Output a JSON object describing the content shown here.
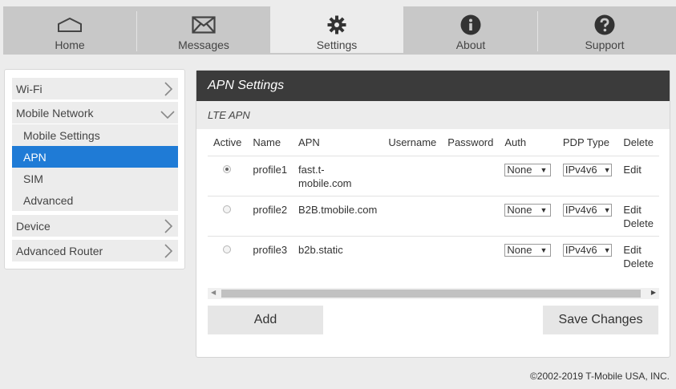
{
  "nav": {
    "tabs": [
      {
        "label": "Home",
        "icon": "home-icon"
      },
      {
        "label": "Messages",
        "icon": "envelope-icon"
      },
      {
        "label": "Settings",
        "icon": "gear-icon"
      },
      {
        "label": "About",
        "icon": "info-icon"
      },
      {
        "label": "Support",
        "icon": "question-icon"
      }
    ],
    "active": "Settings"
  },
  "sidebar": {
    "wifi": "Wi-Fi",
    "mobile_network": "Mobile Network",
    "sub": [
      "Mobile Settings",
      "APN",
      "SIM",
      "Advanced"
    ],
    "active_sub": "APN",
    "device": "Device",
    "advanced_router": "Advanced Router"
  },
  "panel": {
    "title": "APN Settings",
    "subtitle": "LTE APN",
    "columns": [
      "Active",
      "Name",
      "APN",
      "Username",
      "Password",
      "Auth",
      "PDP Type",
      "Delete"
    ],
    "rows": [
      {
        "active": true,
        "name": "profile1",
        "apn": "fast.t-mobile.com",
        "apn_l1": "fast.t-",
        "apn_l2": "mobile.com",
        "username": "",
        "password": "",
        "auth": "None",
        "pdp": "IPv4v6",
        "actions": [
          "Edit"
        ]
      },
      {
        "active": false,
        "name": "profile2",
        "apn": "B2B.tmobile.com",
        "username": "",
        "password": "",
        "auth": "None",
        "pdp": "IPv4v6",
        "actions": [
          "Edit",
          "Delete"
        ]
      },
      {
        "active": false,
        "name": "profile3",
        "apn": "b2b.static",
        "username": "",
        "password": "",
        "auth": "None",
        "pdp": "IPv4v6",
        "actions": [
          "Edit",
          "Delete"
        ]
      }
    ],
    "add_label": "Add",
    "save_label": "Save Changes"
  },
  "footer": "©2002-2019 T-Mobile USA, INC.",
  "colors": {
    "accent": "#1f7bd6",
    "header_bg": "#3b3b3b",
    "nav_bg": "#c8c8c8"
  }
}
